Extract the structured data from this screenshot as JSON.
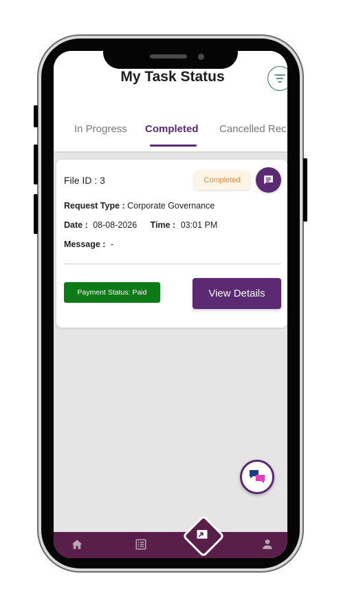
{
  "header": {
    "title": "My Task Status",
    "filter_icon": "filter-icon"
  },
  "tabs": [
    {
      "label": "In Progress",
      "active": false
    },
    {
      "label": "Completed",
      "active": true
    },
    {
      "label": "Cancelled Rec",
      "active": false
    }
  ],
  "task": {
    "file_id_label": "File ID : 3",
    "status": "Completed",
    "request_type_label": "Request Type :",
    "request_type_value": "Corporate Governance",
    "date_label": "Date :",
    "date_value": "08-08-2026",
    "time_label": "Time :",
    "time_value": "03:01 PM",
    "message_label": "Message :",
    "message_value": "-",
    "payment_status": "Payment Status: Paid",
    "view_details_label": "View Details"
  },
  "nav": {
    "items": [
      "home-icon",
      "list-icon",
      "upload-icon",
      "profile-icon"
    ]
  },
  "colors": {
    "brand_purple": "#5b2a73",
    "nav_bg": "#5a1e4a",
    "paid_green": "#0b7a17",
    "completed_orange": "#e08a36"
  }
}
